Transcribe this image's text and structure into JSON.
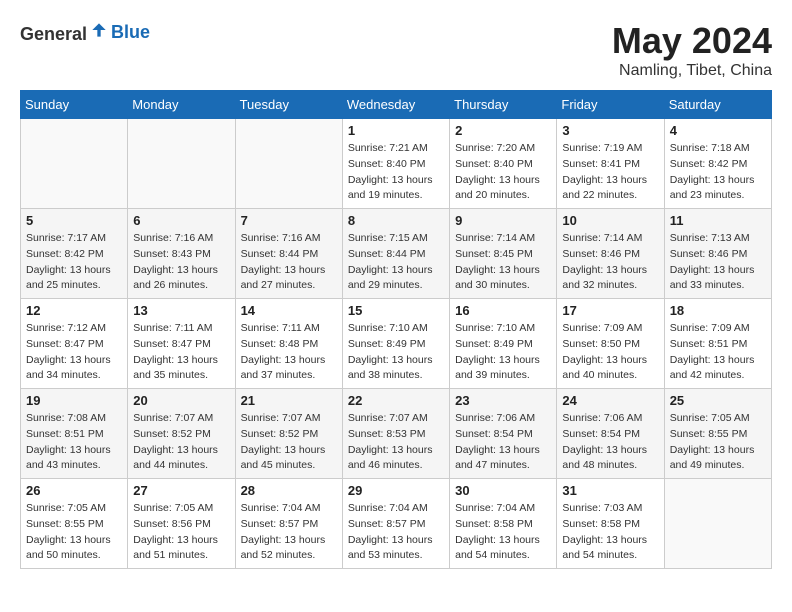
{
  "header": {
    "logo_general": "General",
    "logo_blue": "Blue",
    "month_year": "May 2024",
    "location": "Namling, Tibet, China"
  },
  "days_of_week": [
    "Sunday",
    "Monday",
    "Tuesday",
    "Wednesday",
    "Thursday",
    "Friday",
    "Saturday"
  ],
  "weeks": [
    [
      {
        "day": "",
        "info": ""
      },
      {
        "day": "",
        "info": ""
      },
      {
        "day": "",
        "info": ""
      },
      {
        "day": "1",
        "info": "Sunrise: 7:21 AM\nSunset: 8:40 PM\nDaylight: 13 hours\nand 19 minutes."
      },
      {
        "day": "2",
        "info": "Sunrise: 7:20 AM\nSunset: 8:40 PM\nDaylight: 13 hours\nand 20 minutes."
      },
      {
        "day": "3",
        "info": "Sunrise: 7:19 AM\nSunset: 8:41 PM\nDaylight: 13 hours\nand 22 minutes."
      },
      {
        "day": "4",
        "info": "Sunrise: 7:18 AM\nSunset: 8:42 PM\nDaylight: 13 hours\nand 23 minutes."
      }
    ],
    [
      {
        "day": "5",
        "info": "Sunrise: 7:17 AM\nSunset: 8:42 PM\nDaylight: 13 hours\nand 25 minutes."
      },
      {
        "day": "6",
        "info": "Sunrise: 7:16 AM\nSunset: 8:43 PM\nDaylight: 13 hours\nand 26 minutes."
      },
      {
        "day": "7",
        "info": "Sunrise: 7:16 AM\nSunset: 8:44 PM\nDaylight: 13 hours\nand 27 minutes."
      },
      {
        "day": "8",
        "info": "Sunrise: 7:15 AM\nSunset: 8:44 PM\nDaylight: 13 hours\nand 29 minutes."
      },
      {
        "day": "9",
        "info": "Sunrise: 7:14 AM\nSunset: 8:45 PM\nDaylight: 13 hours\nand 30 minutes."
      },
      {
        "day": "10",
        "info": "Sunrise: 7:14 AM\nSunset: 8:46 PM\nDaylight: 13 hours\nand 32 minutes."
      },
      {
        "day": "11",
        "info": "Sunrise: 7:13 AM\nSunset: 8:46 PM\nDaylight: 13 hours\nand 33 minutes."
      }
    ],
    [
      {
        "day": "12",
        "info": "Sunrise: 7:12 AM\nSunset: 8:47 PM\nDaylight: 13 hours\nand 34 minutes."
      },
      {
        "day": "13",
        "info": "Sunrise: 7:11 AM\nSunset: 8:47 PM\nDaylight: 13 hours\nand 35 minutes."
      },
      {
        "day": "14",
        "info": "Sunrise: 7:11 AM\nSunset: 8:48 PM\nDaylight: 13 hours\nand 37 minutes."
      },
      {
        "day": "15",
        "info": "Sunrise: 7:10 AM\nSunset: 8:49 PM\nDaylight: 13 hours\nand 38 minutes."
      },
      {
        "day": "16",
        "info": "Sunrise: 7:10 AM\nSunset: 8:49 PM\nDaylight: 13 hours\nand 39 minutes."
      },
      {
        "day": "17",
        "info": "Sunrise: 7:09 AM\nSunset: 8:50 PM\nDaylight: 13 hours\nand 40 minutes."
      },
      {
        "day": "18",
        "info": "Sunrise: 7:09 AM\nSunset: 8:51 PM\nDaylight: 13 hours\nand 42 minutes."
      }
    ],
    [
      {
        "day": "19",
        "info": "Sunrise: 7:08 AM\nSunset: 8:51 PM\nDaylight: 13 hours\nand 43 minutes."
      },
      {
        "day": "20",
        "info": "Sunrise: 7:07 AM\nSunset: 8:52 PM\nDaylight: 13 hours\nand 44 minutes."
      },
      {
        "day": "21",
        "info": "Sunrise: 7:07 AM\nSunset: 8:52 PM\nDaylight: 13 hours\nand 45 minutes."
      },
      {
        "day": "22",
        "info": "Sunrise: 7:07 AM\nSunset: 8:53 PM\nDaylight: 13 hours\nand 46 minutes."
      },
      {
        "day": "23",
        "info": "Sunrise: 7:06 AM\nSunset: 8:54 PM\nDaylight: 13 hours\nand 47 minutes."
      },
      {
        "day": "24",
        "info": "Sunrise: 7:06 AM\nSunset: 8:54 PM\nDaylight: 13 hours\nand 48 minutes."
      },
      {
        "day": "25",
        "info": "Sunrise: 7:05 AM\nSunset: 8:55 PM\nDaylight: 13 hours\nand 49 minutes."
      }
    ],
    [
      {
        "day": "26",
        "info": "Sunrise: 7:05 AM\nSunset: 8:55 PM\nDaylight: 13 hours\nand 50 minutes."
      },
      {
        "day": "27",
        "info": "Sunrise: 7:05 AM\nSunset: 8:56 PM\nDaylight: 13 hours\nand 51 minutes."
      },
      {
        "day": "28",
        "info": "Sunrise: 7:04 AM\nSunset: 8:57 PM\nDaylight: 13 hours\nand 52 minutes."
      },
      {
        "day": "29",
        "info": "Sunrise: 7:04 AM\nSunset: 8:57 PM\nDaylight: 13 hours\nand 53 minutes."
      },
      {
        "day": "30",
        "info": "Sunrise: 7:04 AM\nSunset: 8:58 PM\nDaylight: 13 hours\nand 54 minutes."
      },
      {
        "day": "31",
        "info": "Sunrise: 7:03 AM\nSunset: 8:58 PM\nDaylight: 13 hours\nand 54 minutes."
      },
      {
        "day": "",
        "info": ""
      }
    ]
  ]
}
